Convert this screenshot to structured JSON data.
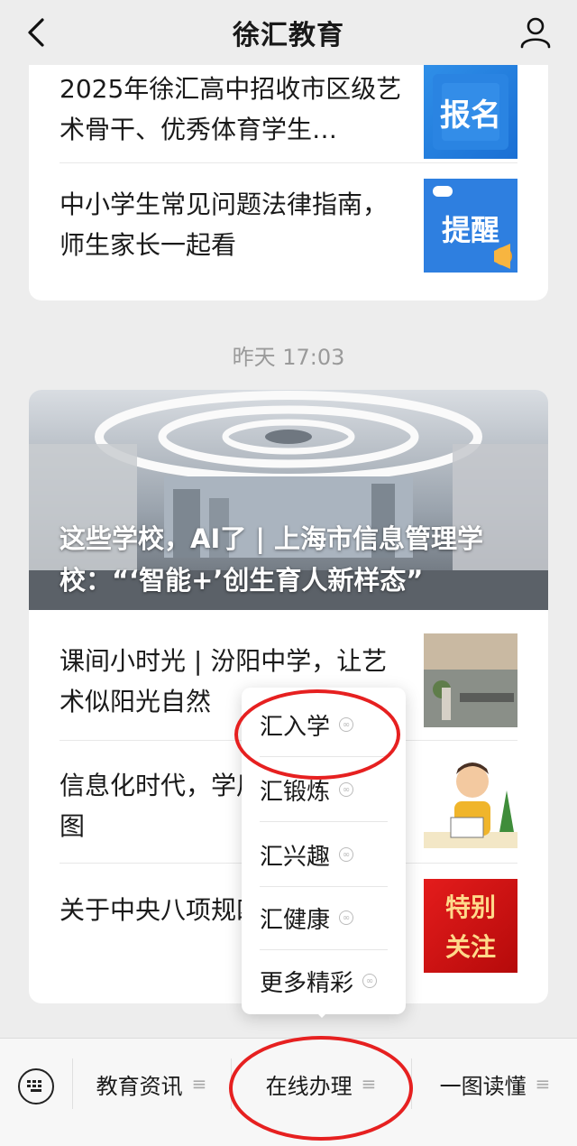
{
  "header": {
    "title": "徐汇教育",
    "back_icon": "chevron-left-icon",
    "profile_icon": "person-icon"
  },
  "top_card": {
    "items": [
      {
        "title": "2025年徐汇高中招收市区级艺术骨干、优秀体育学生…",
        "thumb_text": "报名"
      },
      {
        "title": "中小学生常见问题法律指南，师生家长一起看",
        "thumb_text": "提醒"
      }
    ]
  },
  "timestamp": "昨天 17:03",
  "second_card": {
    "hero_title": "这些学校，AI了 | 上海市信息管理学校：“‘智能+’创生育人新样态”",
    "items": [
      {
        "title": "课间小时光 | 汾阳中学，让艺术似阳光自然"
      },
      {
        "title": "信息化时代，学用好笔记？一图"
      },
      {
        "title": "关于中央八项规四答”说清楚了",
        "thumb_text_1": "特别",
        "thumb_text_2": "关注"
      }
    ]
  },
  "popup_menu": {
    "items": [
      "汇入学",
      "汇锻炼",
      "汇兴趣",
      "汇健康",
      "更多精彩"
    ]
  },
  "bottom_bar": {
    "keyboard_icon": "keyboard-icon",
    "menus": [
      "教育资讯",
      "在线办理",
      "一图读懂"
    ],
    "menu_icon": "≡"
  },
  "colors": {
    "annotation": "#e62020",
    "background": "#ededed",
    "card": "#ffffff"
  }
}
